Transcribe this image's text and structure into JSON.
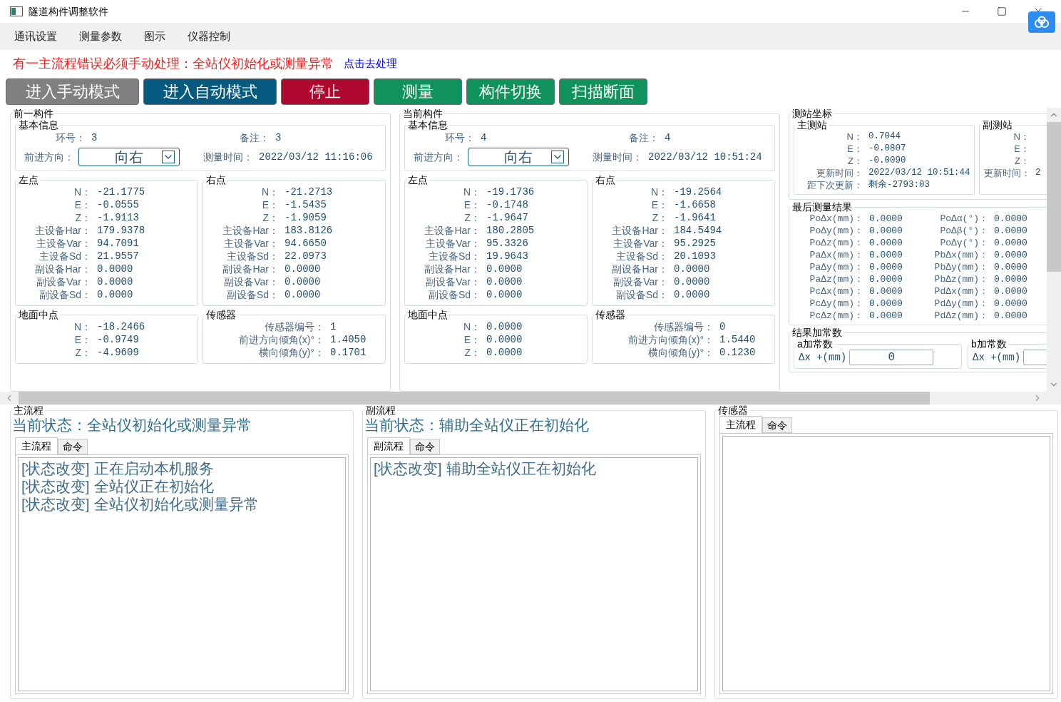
{
  "window": {
    "title": "隧道构件调整软件"
  },
  "menu": [
    "通讯设置",
    "测量参数",
    "图示",
    "仪器控制"
  ],
  "alert": {
    "message": "有一主流程错误必须手动处理：全站仪初始化或测量异常",
    "link": "点击去处理"
  },
  "toolbar": [
    {
      "label": "进入手动模式",
      "color": "#808080"
    },
    {
      "label": "进入自动模式",
      "color": "#065a80"
    },
    {
      "label": "停止",
      "color": "#b0072e"
    },
    {
      "label": "测量",
      "color": "#0f925c"
    },
    {
      "label": "构件切换",
      "color": "#0f925c"
    },
    {
      "label": "扫描断面",
      "color": "#0f925c"
    }
  ],
  "components": [
    {
      "title": "前一构件",
      "basic": {
        "title": "基本信息",
        "ring": {
          "label": "环号：",
          "value": "3"
        },
        "note": {
          "label": "备注：",
          "value": "3"
        },
        "direction": {
          "label": "前进方向：",
          "value": "向右"
        },
        "time": {
          "label": "测量时间：",
          "value": "2022/03/12 11:16:06"
        }
      },
      "points": [
        {
          "title": "左点",
          "rows": [
            {
              "label": "N：",
              "value": "-21.1775"
            },
            {
              "label": "E：",
              "value": "-0.0555"
            },
            {
              "label": "Z：",
              "value": "-1.9113"
            },
            {
              "label": "主设备Har：",
              "value": "179.9378"
            },
            {
              "label": "主设备Var：",
              "value": "94.7091"
            },
            {
              "label": "主设备Sd：",
              "value": "21.9557"
            },
            {
              "label": "副设备Har：",
              "value": "0.0000"
            },
            {
              "label": "副设备Var：",
              "value": "0.0000"
            },
            {
              "label": "副设备Sd：",
              "value": "0.0000"
            }
          ]
        },
        {
          "title": "右点",
          "rows": [
            {
              "label": "N：",
              "value": "-21.2713"
            },
            {
              "label": "E：",
              "value": "-1.5435"
            },
            {
              "label": "Z：",
              "value": "-1.9059"
            },
            {
              "label": "主设备Har：",
              "value": "183.8126"
            },
            {
              "label": "主设备Var：",
              "value": "94.6650"
            },
            {
              "label": "主设备Sd：",
              "value": "22.0973"
            },
            {
              "label": "副设备Har：",
              "value": "0.0000"
            },
            {
              "label": "副设备Var：",
              "value": "0.0000"
            },
            {
              "label": "副设备Sd：",
              "value": "0.0000"
            }
          ]
        }
      ],
      "ground": {
        "title": "地面中点",
        "rows": [
          {
            "label": "N：",
            "value": "-18.2466"
          },
          {
            "label": "E：",
            "value": "-0.9749"
          },
          {
            "label": "Z：",
            "value": "-4.9609"
          }
        ]
      },
      "sensor": {
        "title": "传感器",
        "rows": [
          {
            "label": "传感器编号：",
            "value": "1"
          },
          {
            "label": "前进方向倾角(x)°：",
            "value": "1.4050"
          },
          {
            "label": "横向倾角(y)°：",
            "value": "0.1701"
          }
        ]
      }
    },
    {
      "title": "当前构件",
      "basic": {
        "title": "基本信息",
        "ring": {
          "label": "环号：",
          "value": "4"
        },
        "note": {
          "label": "备注：",
          "value": "4"
        },
        "direction": {
          "label": "前进方向：",
          "value": "向右"
        },
        "time": {
          "label": "测量时间：",
          "value": "2022/03/12 10:51:24"
        }
      },
      "points": [
        {
          "title": "左点",
          "rows": [
            {
              "label": "N：",
              "value": "-19.1736"
            },
            {
              "label": "E：",
              "value": "-0.1748"
            },
            {
              "label": "Z：",
              "value": "-1.9647"
            },
            {
              "label": "主设备Har：",
              "value": "180.2805"
            },
            {
              "label": "主设备Var：",
              "value": "95.3326"
            },
            {
              "label": "主设备Sd：",
              "value": "19.9643"
            },
            {
              "label": "副设备Har：",
              "value": "0.0000"
            },
            {
              "label": "副设备Var：",
              "value": "0.0000"
            },
            {
              "label": "副设备Sd：",
              "value": "0.0000"
            }
          ]
        },
        {
          "title": "右点",
          "rows": [
            {
              "label": "N：",
              "value": "-19.2564"
            },
            {
              "label": "E：",
              "value": "-1.6658"
            },
            {
              "label": "Z：",
              "value": "-1.9641"
            },
            {
              "label": "主设备Har：",
              "value": "184.5494"
            },
            {
              "label": "主设备Var：",
              "value": "95.2925"
            },
            {
              "label": "主设备Sd：",
              "value": "20.1093"
            },
            {
              "label": "副设备Har：",
              "value": "0.0000"
            },
            {
              "label": "副设备Var：",
              "value": "0.0000"
            },
            {
              "label": "副设备Sd：",
              "value": "0.0000"
            }
          ]
        }
      ],
      "ground": {
        "title": "地面中点",
        "rows": [
          {
            "label": "N：",
            "value": "0.0000"
          },
          {
            "label": "E：",
            "value": "0.0000"
          },
          {
            "label": "Z：",
            "value": "0.0000"
          }
        ]
      },
      "sensor": {
        "title": "传感器",
        "rows": [
          {
            "label": "传感器编号：",
            "value": "0"
          },
          {
            "label": "前进方向倾角(x)°：",
            "value": "1.5440"
          },
          {
            "label": "横向倾角(y)°：",
            "value": "0.1230"
          }
        ]
      }
    }
  ],
  "station": {
    "title": "测站坐标",
    "main": {
      "title": "主测站",
      "rows": [
        {
          "label": "N：",
          "value": "0.7044"
        },
        {
          "label": "E：",
          "value": "-0.0807"
        },
        {
          "label": "Z：",
          "value": "-0.0090"
        },
        {
          "label": "更新时间：",
          "value": "2022/03/12 10:51:44"
        },
        {
          "label": "距下次更新：",
          "value": "剩余-2793:03"
        }
      ]
    },
    "sub": {
      "title": "副测站",
      "rows": [
        {
          "label": "N："
        },
        {
          "label": "E："
        },
        {
          "label": "Z："
        },
        {
          "label": "更新时间：",
          "value": "2"
        }
      ]
    }
  },
  "results": {
    "title": "最后测量结果",
    "rows": [
      {
        "label": "PoΔx(mm)：",
        "value": "0.0000"
      },
      {
        "label": "PoΔy(mm)：",
        "value": "0.0000"
      },
      {
        "label": "PoΔz(mm)：",
        "value": "0.0000"
      },
      {
        "label": "PaΔx(mm)：",
        "value": "0.0000"
      },
      {
        "label": "PaΔy(mm)：",
        "value": "0.0000"
      },
      {
        "label": "PaΔz(mm)：",
        "value": "0.0000"
      },
      {
        "label": "PcΔx(mm)：",
        "value": "0.0000"
      },
      {
        "label": "PcΔy(mm)：",
        "value": "0.0000"
      },
      {
        "label": "PcΔz(mm)：",
        "value": "0.0000"
      },
      {
        "label": "PoΔα(°)：",
        "value": "0.0000"
      },
      {
        "label": "PoΔβ(°)：",
        "value": "0.0000"
      },
      {
        "label": "PoΔγ(°)：",
        "value": "0.0000"
      },
      {
        "label": "PbΔx(mm)：",
        "value": "0.0000"
      },
      {
        "label": "PbΔy(mm)：",
        "value": "0.0000"
      },
      {
        "label": "PbΔz(mm)：",
        "value": "0.0000"
      },
      {
        "label": "PdΔx(mm)：",
        "value": "0.0000"
      },
      {
        "label": "PdΔy(mm)：",
        "value": "0.0000"
      },
      {
        "label": "PdΔz(mm)：",
        "value": "0.0000"
      }
    ]
  },
  "constants": {
    "title": "结果加常数",
    "groups": [
      {
        "title": "a加常数",
        "field_label": "Δx +(mm)",
        "value": "0"
      },
      {
        "title": "b加常数",
        "field_label": "Δx +(mm)"
      }
    ]
  },
  "panes": [
    {
      "title": "主流程",
      "status": "当前状态：全站仪初始化或测量异常",
      "tabs": [
        {
          "label": "主流程",
          "selected": true
        },
        {
          "label": "命令",
          "selected": false
        }
      ],
      "log": [
        "[状态改变] 正在启动本机服务",
        "[状态改变] 全站仪正在初始化",
        "[状态改变] 全站仪初始化或测量异常"
      ]
    },
    {
      "title": "副流程",
      "status": "当前状态：辅助全站仪正在初始化",
      "tabs": [
        {
          "label": "副流程",
          "selected": true
        },
        {
          "label": "命令",
          "selected": false
        }
      ],
      "log": [
        "[状态改变] 辅助全站仪正在初始化"
      ]
    },
    {
      "title": "传感器",
      "tabs": [
        {
          "label": "主流程",
          "selected": true
        },
        {
          "label": "命令",
          "selected": false
        }
      ]
    }
  ]
}
